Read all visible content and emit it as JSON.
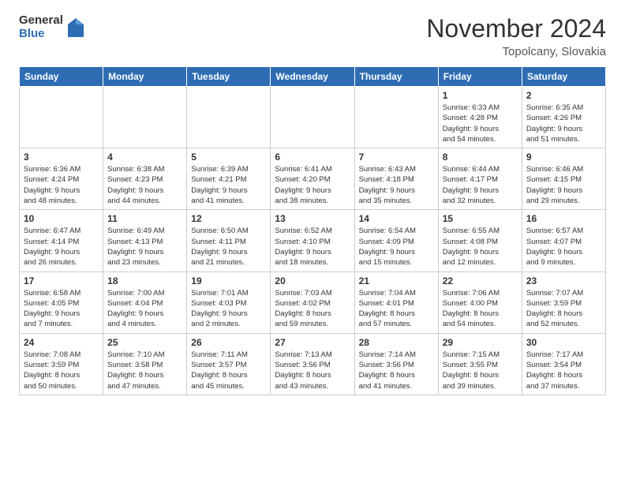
{
  "header": {
    "logo_general": "General",
    "logo_blue": "Blue",
    "month_title": "November 2024",
    "location": "Topolcany, Slovakia"
  },
  "calendar": {
    "days_of_week": [
      "Sunday",
      "Monday",
      "Tuesday",
      "Wednesday",
      "Thursday",
      "Friday",
      "Saturday"
    ],
    "weeks": [
      [
        {
          "day": "",
          "info": ""
        },
        {
          "day": "",
          "info": ""
        },
        {
          "day": "",
          "info": ""
        },
        {
          "day": "",
          "info": ""
        },
        {
          "day": "",
          "info": ""
        },
        {
          "day": "1",
          "info": "Sunrise: 6:33 AM\nSunset: 4:28 PM\nDaylight: 9 hours\nand 54 minutes."
        },
        {
          "day": "2",
          "info": "Sunrise: 6:35 AM\nSunset: 4:26 PM\nDaylight: 9 hours\nand 51 minutes."
        }
      ],
      [
        {
          "day": "3",
          "info": "Sunrise: 6:36 AM\nSunset: 4:24 PM\nDaylight: 9 hours\nand 48 minutes."
        },
        {
          "day": "4",
          "info": "Sunrise: 6:38 AM\nSunset: 4:23 PM\nDaylight: 9 hours\nand 44 minutes."
        },
        {
          "day": "5",
          "info": "Sunrise: 6:39 AM\nSunset: 4:21 PM\nDaylight: 9 hours\nand 41 minutes."
        },
        {
          "day": "6",
          "info": "Sunrise: 6:41 AM\nSunset: 4:20 PM\nDaylight: 9 hours\nand 38 minutes."
        },
        {
          "day": "7",
          "info": "Sunrise: 6:43 AM\nSunset: 4:18 PM\nDaylight: 9 hours\nand 35 minutes."
        },
        {
          "day": "8",
          "info": "Sunrise: 6:44 AM\nSunset: 4:17 PM\nDaylight: 9 hours\nand 32 minutes."
        },
        {
          "day": "9",
          "info": "Sunrise: 6:46 AM\nSunset: 4:15 PM\nDaylight: 9 hours\nand 29 minutes."
        }
      ],
      [
        {
          "day": "10",
          "info": "Sunrise: 6:47 AM\nSunset: 4:14 PM\nDaylight: 9 hours\nand 26 minutes."
        },
        {
          "day": "11",
          "info": "Sunrise: 6:49 AM\nSunset: 4:13 PM\nDaylight: 9 hours\nand 23 minutes."
        },
        {
          "day": "12",
          "info": "Sunrise: 6:50 AM\nSunset: 4:11 PM\nDaylight: 9 hours\nand 21 minutes."
        },
        {
          "day": "13",
          "info": "Sunrise: 6:52 AM\nSunset: 4:10 PM\nDaylight: 9 hours\nand 18 minutes."
        },
        {
          "day": "14",
          "info": "Sunrise: 6:54 AM\nSunset: 4:09 PM\nDaylight: 9 hours\nand 15 minutes."
        },
        {
          "day": "15",
          "info": "Sunrise: 6:55 AM\nSunset: 4:08 PM\nDaylight: 9 hours\nand 12 minutes."
        },
        {
          "day": "16",
          "info": "Sunrise: 6:57 AM\nSunset: 4:07 PM\nDaylight: 9 hours\nand 9 minutes."
        }
      ],
      [
        {
          "day": "17",
          "info": "Sunrise: 6:58 AM\nSunset: 4:05 PM\nDaylight: 9 hours\nand 7 minutes."
        },
        {
          "day": "18",
          "info": "Sunrise: 7:00 AM\nSunset: 4:04 PM\nDaylight: 9 hours\nand 4 minutes."
        },
        {
          "day": "19",
          "info": "Sunrise: 7:01 AM\nSunset: 4:03 PM\nDaylight: 9 hours\nand 2 minutes."
        },
        {
          "day": "20",
          "info": "Sunrise: 7:03 AM\nSunset: 4:02 PM\nDaylight: 8 hours\nand 59 minutes."
        },
        {
          "day": "21",
          "info": "Sunrise: 7:04 AM\nSunset: 4:01 PM\nDaylight: 8 hours\nand 57 minutes."
        },
        {
          "day": "22",
          "info": "Sunrise: 7:06 AM\nSunset: 4:00 PM\nDaylight: 8 hours\nand 54 minutes."
        },
        {
          "day": "23",
          "info": "Sunrise: 7:07 AM\nSunset: 3:59 PM\nDaylight: 8 hours\nand 52 minutes."
        }
      ],
      [
        {
          "day": "24",
          "info": "Sunrise: 7:08 AM\nSunset: 3:59 PM\nDaylight: 8 hours\nand 50 minutes."
        },
        {
          "day": "25",
          "info": "Sunrise: 7:10 AM\nSunset: 3:58 PM\nDaylight: 8 hours\nand 47 minutes."
        },
        {
          "day": "26",
          "info": "Sunrise: 7:11 AM\nSunset: 3:57 PM\nDaylight: 8 hours\nand 45 minutes."
        },
        {
          "day": "27",
          "info": "Sunrise: 7:13 AM\nSunset: 3:56 PM\nDaylight: 8 hours\nand 43 minutes."
        },
        {
          "day": "28",
          "info": "Sunrise: 7:14 AM\nSunset: 3:56 PM\nDaylight: 8 hours\nand 41 minutes."
        },
        {
          "day": "29",
          "info": "Sunrise: 7:15 AM\nSunset: 3:55 PM\nDaylight: 8 hours\nand 39 minutes."
        },
        {
          "day": "30",
          "info": "Sunrise: 7:17 AM\nSunset: 3:54 PM\nDaylight: 8 hours\nand 37 minutes."
        }
      ]
    ]
  }
}
